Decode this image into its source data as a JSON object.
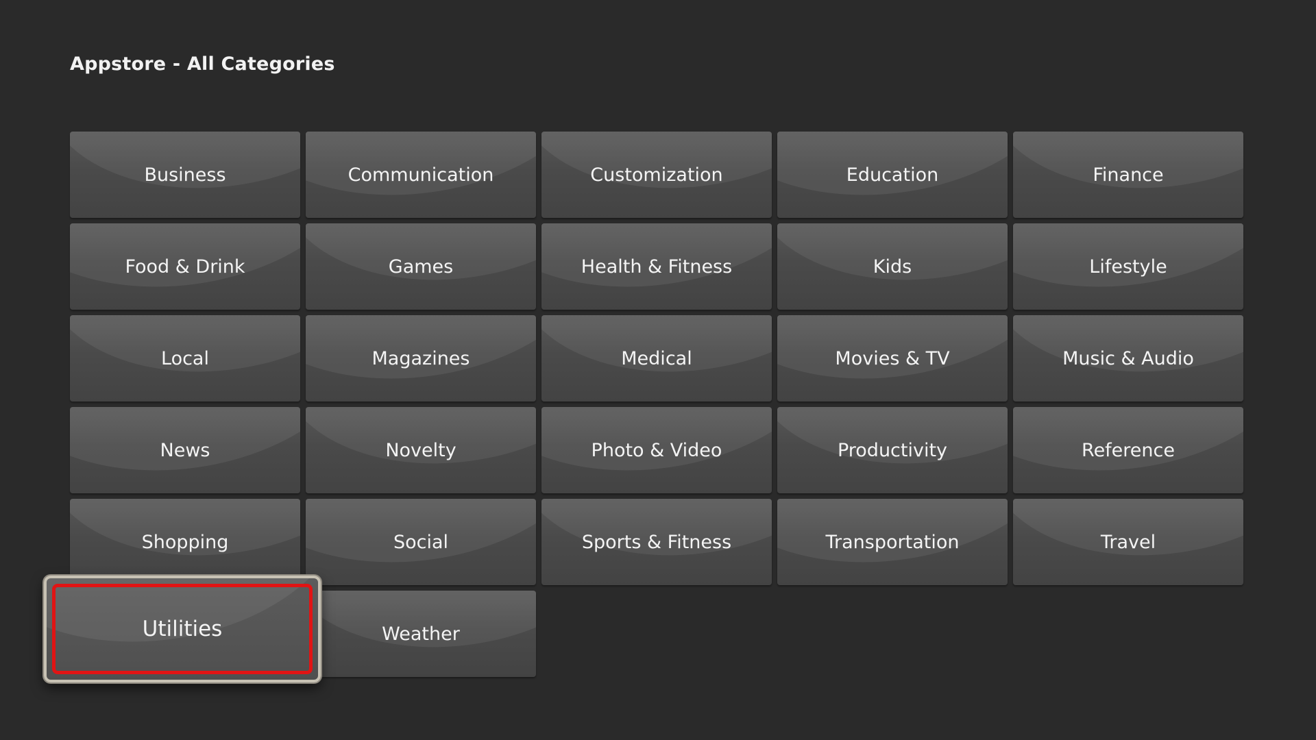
{
  "header": {
    "title": "Appstore - All Categories"
  },
  "categories": [
    {
      "label": "Business"
    },
    {
      "label": "Communication"
    },
    {
      "label": "Customization"
    },
    {
      "label": "Education"
    },
    {
      "label": "Finance"
    },
    {
      "label": "Food & Drink"
    },
    {
      "label": "Games"
    },
    {
      "label": "Health & Fitness"
    },
    {
      "label": "Kids"
    },
    {
      "label": "Lifestyle"
    },
    {
      "label": "Local"
    },
    {
      "label": "Magazines"
    },
    {
      "label": "Medical"
    },
    {
      "label": "Movies & TV"
    },
    {
      "label": "Music & Audio"
    },
    {
      "label": "News"
    },
    {
      "label": "Novelty"
    },
    {
      "label": "Photo & Video"
    },
    {
      "label": "Productivity"
    },
    {
      "label": "Reference"
    },
    {
      "label": "Shopping"
    },
    {
      "label": "Social"
    },
    {
      "label": "Sports & Fitness"
    },
    {
      "label": "Transportation"
    },
    {
      "label": "Travel"
    },
    {
      "label": "Utilities"
    },
    {
      "label": "Weather"
    }
  ],
  "focused_category": "Utilities",
  "colors": {
    "focus_ring": "#e11414",
    "background": "#2a2a2a"
  }
}
